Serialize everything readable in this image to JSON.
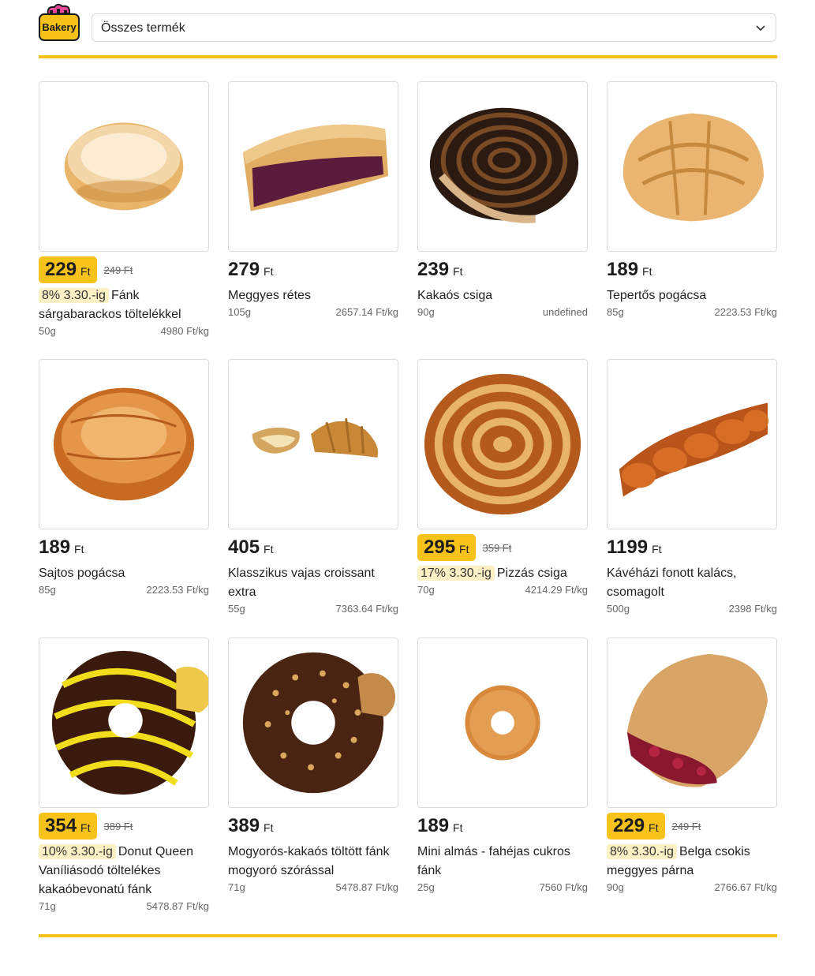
{
  "brand": {
    "logo_text": "Bakery"
  },
  "filter": {
    "selected": "Összes termék"
  },
  "colors": {
    "accent": "#f6c21a",
    "badge": "#fdf0c4"
  },
  "products": [
    {
      "price": "229",
      "currency": "Ft",
      "old_price": "249 Ft",
      "badge": "8% 3.30.-ig",
      "name": "Fánk sárgabarackos töltelékkel",
      "weight": "50g",
      "unit_price": "4980 Ft/kg",
      "image": "donut-plain"
    },
    {
      "price": "279",
      "currency": "Ft",
      "old_price": "",
      "badge": "",
      "name": "Meggyes rétes",
      "weight": "105g",
      "unit_price": "2657.14 Ft/kg",
      "image": "cherry-strudel"
    },
    {
      "price": "239",
      "currency": "Ft",
      "old_price": "",
      "badge": "",
      "name": "Kakaós csiga",
      "weight": "90g",
      "unit_price": "undefined",
      "image": "cocoa-roll"
    },
    {
      "price": "189",
      "currency": "Ft",
      "old_price": "",
      "badge": "",
      "name": "Tepertős pogácsa",
      "weight": "85g",
      "unit_price": "2223.53 Ft/kg",
      "image": "scone"
    },
    {
      "price": "189",
      "currency": "Ft",
      "old_price": "",
      "badge": "",
      "name": "Sajtos pogácsa",
      "weight": "85g",
      "unit_price": "2223.53 Ft/kg",
      "image": "cheese-scone"
    },
    {
      "price": "405",
      "currency": "Ft",
      "old_price": "",
      "badge": "",
      "name": "Klasszikus vajas croissant extra",
      "weight": "55g",
      "unit_price": "7363.64 Ft/kg",
      "image": "croissant"
    },
    {
      "price": "295",
      "currency": "Ft",
      "old_price": "359 Ft",
      "badge": "17% 3.30.-ig",
      "name": "Pizzás csiga",
      "weight": "70g",
      "unit_price": "4214.29 Ft/kg",
      "image": "pizza-roll"
    },
    {
      "price": "1199",
      "currency": "Ft",
      "old_price": "",
      "badge": "",
      "name": "Kávéházi fonott kalács, csomagolt",
      "weight": "500g",
      "unit_price": "2398 Ft/kg",
      "image": "braided-bread"
    },
    {
      "price": "354",
      "currency": "Ft",
      "old_price": "389 Ft",
      "badge": "10% 3.30.-ig",
      "name": "Donut Queen Vaníliásodó töltelékes kakaóbevonatú fánk",
      "weight": "71g",
      "unit_price": "5478.87 Ft/kg",
      "image": "striped-donut"
    },
    {
      "price": "389",
      "currency": "Ft",
      "old_price": "",
      "badge": "",
      "name": "Mogyorós-kakaós töltött fánk mogyoró szórással",
      "weight": "71g",
      "unit_price": "5478.87 Ft/kg",
      "image": "nut-donut"
    },
    {
      "price": "189",
      "currency": "Ft",
      "old_price": "",
      "badge": "",
      "name": "Mini almás - fahéjas cukros fánk",
      "weight": "25g",
      "unit_price": "7560 Ft/kg",
      "image": "mini-donut"
    },
    {
      "price": "229",
      "currency": "Ft",
      "old_price": "249 Ft",
      "badge": "8% 3.30.-ig",
      "name": "Belga csokis meggyes párna",
      "weight": "90g",
      "unit_price": "2766.67 Ft/kg",
      "image": "cherry-pastry"
    }
  ]
}
